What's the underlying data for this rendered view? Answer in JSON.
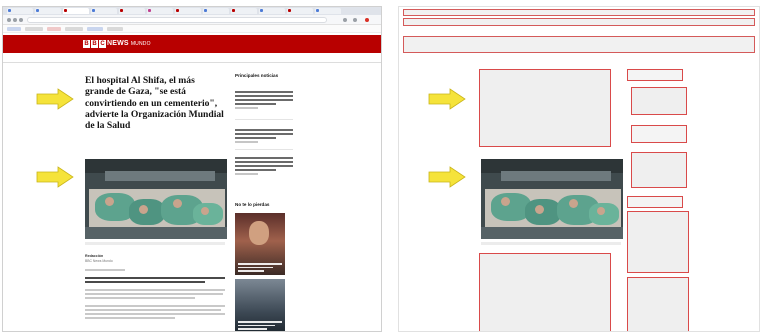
{
  "left_screenshot": {
    "site": {
      "logo_letters": [
        "B",
        "B",
        "C"
      ],
      "name": "NEWS",
      "section": "MUNDO"
    },
    "headline": "El hospital Al Shifa, el más grande de Gaza, \"se está convirtiendo en un cementerio\", advierte la Organización Mundial de la Salud",
    "sidebar": {
      "top_news_heading": "Principales noticias",
      "dont_miss_heading": "No te lo pierdas"
    },
    "byline": "Redacción",
    "byline_sub": "BBC News Mundo"
  },
  "annotations": {
    "arrow_color": "#f5e33a",
    "arrow_icon": "arrow-right-icon"
  },
  "wireframe": {
    "box_color": "#d94a4a"
  }
}
